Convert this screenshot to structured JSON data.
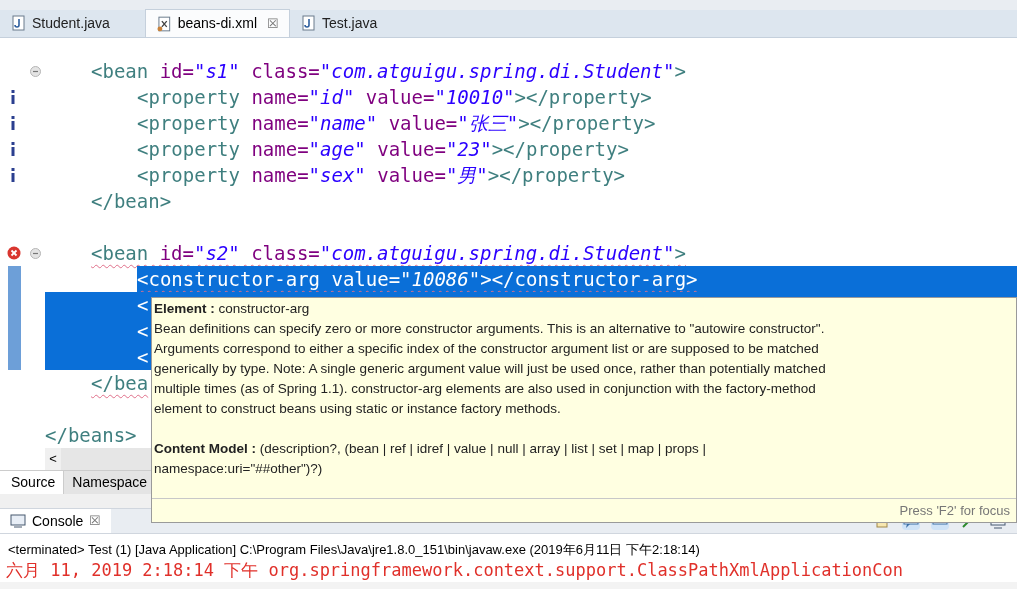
{
  "editor_tabs": [
    {
      "label": "Student.java",
      "kind": "java",
      "selected": false
    },
    {
      "label": "beans-di.xml",
      "kind": "xml",
      "selected": true,
      "close": "☒"
    },
    {
      "label": "Test.java",
      "kind": "java",
      "selected": false
    }
  ],
  "code": [
    {
      "children": [
        {
          "foldable": true,
          "info": false,
          "error": false,
          "selected": false,
          "squiggle": false,
          "tokens": [
            {
              "kind": "tag",
              "text": "<bean"
            },
            {
              "kind": "attr",
              "text": " id="
            },
            {
              "kind": "value",
              "text": "\"s1\""
            },
            {
              "kind": "attr",
              "text": " class="
            },
            {
              "kind": "value",
              "text": "\"com.atguigu.spring.di.Student\""
            },
            {
              "kind": "tag",
              "text": ">"
            }
          ],
          "children": [
            {
              "foldable": false,
              "info": true,
              "error": false,
              "selected": false,
              "squiggle": false,
              "tokens": [
                {
                  "kind": "tag",
                  "text": "<property"
                },
                {
                  "kind": "attr",
                  "text": " name="
                },
                {
                  "kind": "value",
                  "text": "\"id\""
                },
                {
                  "kind": "attr",
                  "text": " value="
                },
                {
                  "kind": "value",
                  "text": "\"10010\""
                },
                {
                  "kind": "tag",
                  "text": "></property>"
                }
              ]
            },
            {
              "foldable": false,
              "info": true,
              "error": false,
              "selected": false,
              "squiggle": false,
              "tokens": [
                {
                  "kind": "tag",
                  "text": "<property"
                },
                {
                  "kind": "attr",
                  "text": " name="
                },
                {
                  "kind": "value",
                  "text": "\"name\""
                },
                {
                  "kind": "attr",
                  "text": " value="
                },
                {
                  "kind": "value",
                  "text": "\"张三\""
                },
                {
                  "kind": "tag",
                  "text": "></property>"
                }
              ]
            },
            {
              "foldable": false,
              "info": true,
              "error": false,
              "selected": false,
              "squiggle": false,
              "tokens": [
                {
                  "kind": "tag",
                  "text": "<property"
                },
                {
                  "kind": "attr",
                  "text": " name="
                },
                {
                  "kind": "value",
                  "text": "\"age\""
                },
                {
                  "kind": "attr",
                  "text": " value="
                },
                {
                  "kind": "value",
                  "text": "\"23\""
                },
                {
                  "kind": "tag",
                  "text": "></property>"
                }
              ]
            },
            {
              "foldable": false,
              "info": true,
              "error": false,
              "selected": false,
              "squiggle": false,
              "tokens": [
                {
                  "kind": "tag",
                  "text": "<property"
                },
                {
                  "kind": "attr",
                  "text": " name="
                },
                {
                  "kind": "value",
                  "text": "\"sex\""
                },
                {
                  "kind": "attr",
                  "text": " value="
                },
                {
                  "kind": "value",
                  "text": "\"男\""
                },
                {
                  "kind": "tag",
                  "text": "></property>"
                }
              ]
            }
          ]
        },
        {
          "foldable": false,
          "info": false,
          "error": false,
          "selected": false,
          "squiggle": false,
          "tokens": [
            {
              "kind": "tag",
              "text": "</bean>"
            }
          ]
        },
        {
          "foldable": false,
          "info": false,
          "error": false,
          "selected": false,
          "squiggle": false
        },
        {
          "foldable": true,
          "info": false,
          "error": true,
          "selected": false,
          "squiggle": true,
          "tokens": [
            {
              "kind": "tag",
              "text": "<bean"
            },
            {
              "kind": "attr",
              "text": " id="
            },
            {
              "kind": "value",
              "text": "\"s2\""
            },
            {
              "kind": "attr",
              "text": " class="
            },
            {
              "kind": "value",
              "text": "\"com.atguigu.spring.di.Student\""
            },
            {
              "kind": "tag",
              "text": ">"
            }
          ],
          "children": [
            {
              "foldable": false,
              "info": false,
              "error": false,
              "selected": true,
              "squiggle": true,
              "tokens": [
                {
                  "kind": "tag",
                  "text": "<constructor-arg"
                },
                {
                  "kind": "attr",
                  "text": " value="
                },
                {
                  "kind": "value",
                  "text": "\"10086\""
                },
                {
                  "kind": "tag",
                  "text": "></constructor-arg>"
                }
              ]
            },
            {
              "foldable": false,
              "info": false,
              "error": false,
              "selected": true,
              "squiggle": false,
              "tokens": [
                {
                  "kind": "tag",
                  "text": "<"
                }
              ]
            },
            {
              "foldable": false,
              "info": false,
              "error": false,
              "selected": true,
              "squiggle": false,
              "tokens": [
                {
                  "kind": "tag",
                  "text": "<"
                }
              ]
            },
            {
              "foldable": false,
              "info": false,
              "error": false,
              "selected": true,
              "squiggle": false,
              "tokens": [
                {
                  "kind": "tag",
                  "text": "<"
                }
              ]
            }
          ]
        },
        {
          "foldable": false,
          "info": false,
          "error": false,
          "selected": false,
          "squiggle": true,
          "tokens": [
            {
              "kind": "tag",
              "text": "</bea"
            }
          ]
        },
        {
          "foldable": false,
          "info": false,
          "error": false,
          "selected": false,
          "squiggle": false
        }
      ]
    },
    {
      "foldable": false,
      "info": false,
      "error": false,
      "selected": false,
      "squiggle": false,
      "tokens": [
        {
          "kind": "tag",
          "text": "</beans>"
        }
      ]
    }
  ],
  "scroll_left": "<",
  "bottom_tabs": [
    {
      "label": "Source",
      "selected": true
    },
    {
      "label": "Namespace",
      "selected": false
    }
  ],
  "tooltip": {
    "heading": "**Element :** constructor-arg",
    "description": "Bean definitions can specify zero or more constructor arguments. This is an alternative to \"autowire constructor\". Arguments correspond to either a specific index of the constructor argument list or are supposed to be matched generically by type. Note: A single generic argument value will just be used once, rather than potentially matched multiple times (as of Spring 1.1). constructor-arg elements are also used in conjunction with the factory-method element to construct beans using static or instance factory methods.",
    "content_model": "**Content Model :** (description?, (bean | ref | idref | value | null | array | list | set | map | props | namespace:uri=\"##other\")?)",
    "hint": "Press 'F2' for focus"
  },
  "console": {
    "tab": "Console",
    "close": "☒",
    "status": "<terminated> Test (1) [Java Application] C:\\Program Files\\Java\\jre1.8.0_151\\bin\\javaw.exe (2019年6月11日 下午2:18:14)",
    "output": "六月 11, 2019 2:18:14 下午 org.springframework.context.support.ClassPathXmlApplicationCon"
  }
}
